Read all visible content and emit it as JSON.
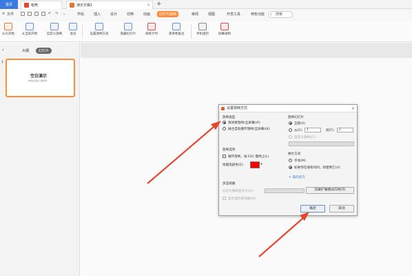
{
  "titlebar": {
    "home_tab": "首页",
    "shell_tab": "稻壳",
    "doc_tab": "演示文稿1",
    "new_tab": "+"
  },
  "menubar": {
    "file": "文件",
    "items": [
      "开始",
      "插入",
      "设计",
      "切换",
      "动画",
      "幻灯片放映",
      "审阅",
      "视图",
      "开发工具",
      "特色功能"
    ],
    "active_index": 5,
    "search": "搜索"
  },
  "ribbon": {
    "buttons": [
      "从头开始",
      "从当前开始",
      "自定义放映",
      "会议",
      "设置放映方式",
      "隐藏幻灯片",
      "排练计时",
      "演讲者备注",
      "手机遥控",
      "屏幕录制"
    ]
  },
  "leftpanel": {
    "tab_outline": "大纲",
    "tab_slides": "幻灯片",
    "slide_number": "1",
    "thumb_title": "空白演示",
    "thumb_subtitle": "单击此处输入副标题"
  },
  "dialog": {
    "title": "设置放映方式",
    "section_type": "放映类型",
    "opt_speaker": "演讲者放映(全屏幕)(P)",
    "opt_kiosk": "展台自动循环放映(全屏幕)(K)",
    "section_slides": "放映幻灯片",
    "opt_all": "全部(A)",
    "opt_from": "从(F):",
    "from_value": "1",
    "to_label": "到(T):",
    "to_value": "1",
    "opt_custom": "自定义放映(C):",
    "section_options": "放映选项",
    "opt_loop": "循环放映，按 ESC 键终止(L)",
    "pen_color_label": "绘图笔颜色(E):",
    "pen_color": "#ff0000",
    "section_advance": "换片方式",
    "opt_manual": "手动(M)",
    "opt_timing": "如果存在排练时间，则使用它(U)",
    "tips_link": "操作技巧",
    "section_monitor": "多监视器",
    "monitor_label": "幻灯片放映显示于(O):",
    "dual_screen_btn": "双屏扩展模式向导(S)",
    "presenter_view": "显示演示者视图(W)",
    "ok": "确定",
    "cancel": "取消"
  },
  "colors": {
    "accent": "#ff8c3b",
    "home_tab": "#3b7ae0",
    "arrow": "#e8452f"
  }
}
